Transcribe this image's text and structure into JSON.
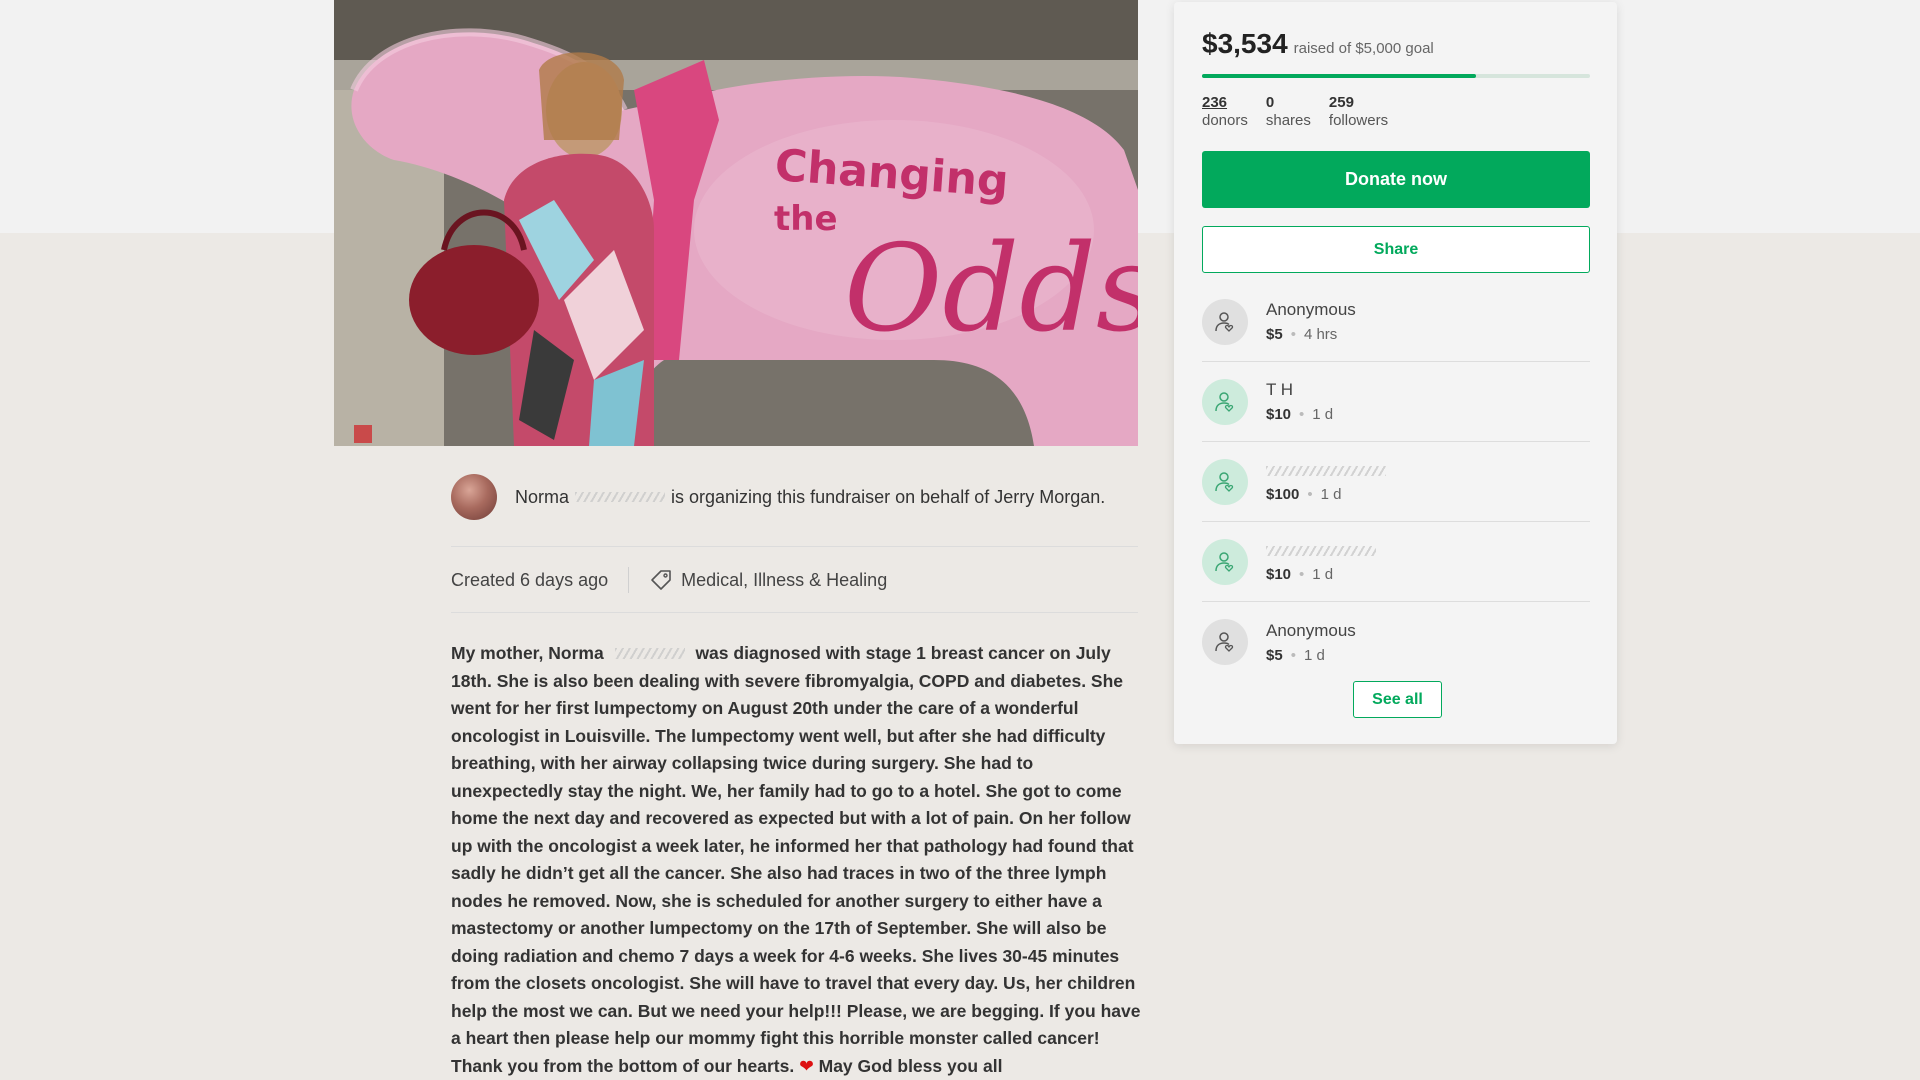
{
  "hero": {
    "sign_line1": "Changing",
    "sign_line2": "the",
    "sign_line3": "Odds"
  },
  "organizer": {
    "first_name": "Norma",
    "text": "is organizing this fundraiser on behalf of Jerry Morgan."
  },
  "meta": {
    "created": "Created 6 days ago",
    "category": "Medical, Illness & Healing"
  },
  "story": {
    "p1_before_name": "My mother, Norma",
    "p1_after_name": "was diagnosed with stage 1 breast cancer on July 18th. She is also been dealing with severe fibromyalgia, COPD and  diabetes. She went for her first lumpectomy on August 20th under the care of a wonderful oncologist in Louisville. The lumpectomy went well, but after she had difficulty breathing, with her airway collapsing twice during surgery. She had to unexpectedly stay the night. We, her family had to go to a hotel.  She got to come home the next day and recovered as expected but with a lot of pain. On her follow up with the oncologist a week later, he informed her that pathology had found that sadly he didn’t get all the cancer. She also had traces in two of the three lymph nodes he removed. Now, she is scheduled for another surgery to either have a mastectomy or another lumpectomy on the 17th of September. She will also be doing radiation and chemo 7 days a week for 4-6 weeks. She lives 30-45 minutes from the closets oncologist. She will have to travel that every day. Us, her children help the most we can. But we need your help!!! Please, we are begging. If you have a heart then please help our mommy fight this horrible monster called cancer! Thank you from the bottom of our hearts.",
    "heart": "❤",
    "closing": "May God bless you all"
  },
  "sidebar": {
    "raised_amount": "$3,534",
    "goal_text": "raised of $5,000 goal",
    "progress": 0.707,
    "stats": [
      {
        "num": "236",
        "label": "donors"
      },
      {
        "num": "0",
        "label": "shares"
      },
      {
        "num": "259",
        "label": "followers"
      }
    ],
    "donate_label": "Donate now",
    "share_label": "Share",
    "see_all_label": "See all",
    "donations": [
      {
        "name": "Anonymous",
        "amount": "$5",
        "time": "4 hrs"
      },
      {
        "name": "T H",
        "amount": "$10",
        "time": "1 d"
      },
      {
        "name": "",
        "amount": "$100",
        "time": "1 d"
      },
      {
        "name": "",
        "amount": "$10",
        "time": "1 d"
      },
      {
        "name": "Anonymous",
        "amount": "$5",
        "time": "1 d"
      }
    ]
  },
  "colors": {
    "brand_green": "#02a95c",
    "heart": "#d11111"
  },
  "icons": [
    "tag-icon",
    "user-heart-icon"
  ]
}
